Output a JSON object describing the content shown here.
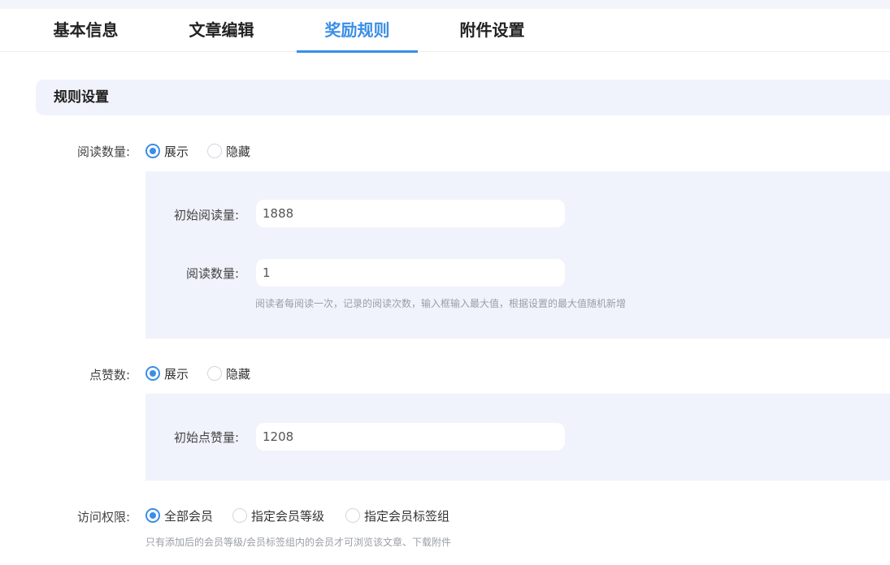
{
  "tabs": [
    {
      "label": "基本信息",
      "active": false
    },
    {
      "label": "文章编辑",
      "active": false
    },
    {
      "label": "奖励规则",
      "active": true
    },
    {
      "label": "附件设置",
      "active": false
    }
  ],
  "section": {
    "title": "规则设置"
  },
  "read_count": {
    "label": "阅读数量:",
    "options": [
      "展示",
      "隐藏"
    ],
    "selected": "展示",
    "initial_label": "初始阅读量:",
    "initial_value": "1888",
    "count_label": "阅读数量:",
    "count_value": "1",
    "hint": "阅读者每阅读一次，记录的阅读次数，输入框输入最大值，根据设置的最大值随机新增"
  },
  "likes": {
    "label": "点赞数:",
    "options": [
      "展示",
      "隐藏"
    ],
    "selected": "展示",
    "initial_label": "初始点赞量:",
    "initial_value": "1208"
  },
  "access": {
    "label": "访问权限:",
    "options": [
      "全部会员",
      "指定会员等级",
      "指定会员标签组"
    ],
    "selected": "全部会员",
    "hint": "只有添加后的会员等级/会员标签组内的会员才可浏览该文章、下载附件"
  },
  "colors": {
    "accent": "#3a8ee6",
    "panel_bg": "#f0f3fb"
  }
}
